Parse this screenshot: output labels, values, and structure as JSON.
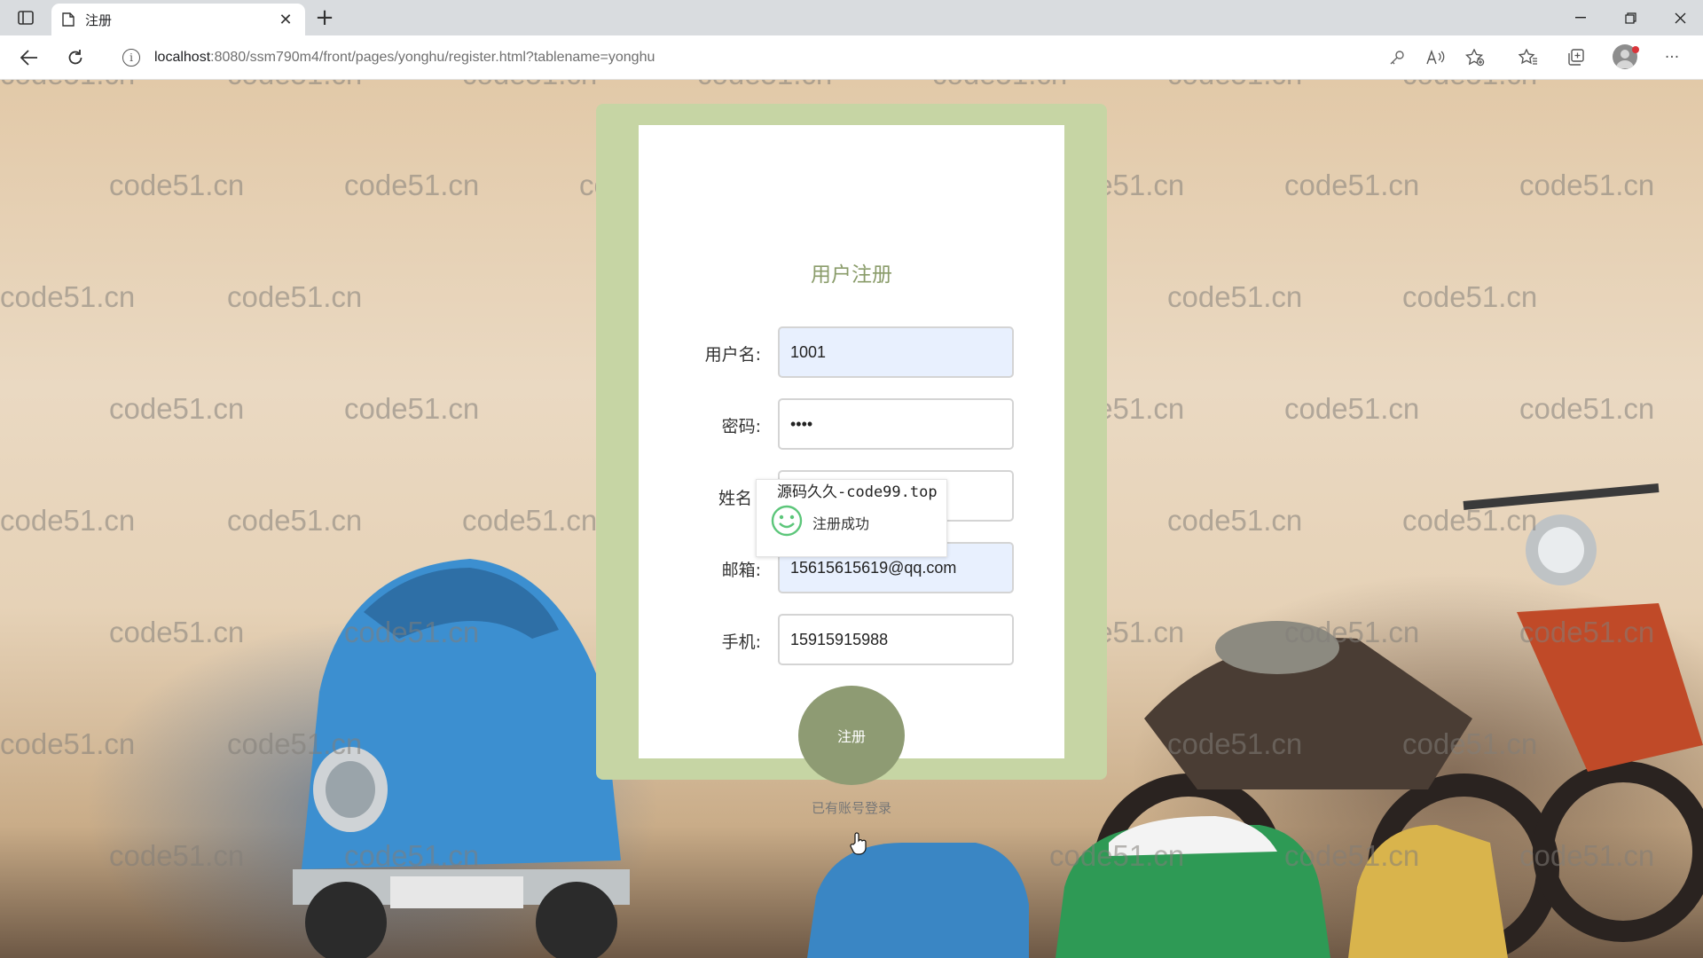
{
  "browser": {
    "tab_title": "注册",
    "url_host": "localhost",
    "url_rest": ":8080/ssm790m4/front/pages/yonghu/register.html?tablename=yonghu"
  },
  "watermark_text": "code51.cn",
  "form": {
    "title": "用户注册",
    "fields": [
      {
        "label": "用户名:",
        "value": "1001",
        "autofill": true
      },
      {
        "label": "密码:",
        "value": "••••",
        "autofill": false
      },
      {
        "label": "姓名",
        "value": "",
        "autofill": false
      },
      {
        "label": "邮箱:",
        "value": "15615615619@qq.com",
        "autofill": true
      },
      {
        "label": "手机:",
        "value": "15915915988",
        "autofill": false
      }
    ],
    "submit_label": "注册",
    "login_link": "已有账号登录"
  },
  "toast": {
    "title": "源码久久-code99.top",
    "message": "注册成功",
    "icon": "smiley-icon"
  },
  "colors": {
    "card_border": "#c6d5a4",
    "title": "#8a9c6a",
    "button": "#8e9b73",
    "autofill": "#e8f0fe"
  }
}
